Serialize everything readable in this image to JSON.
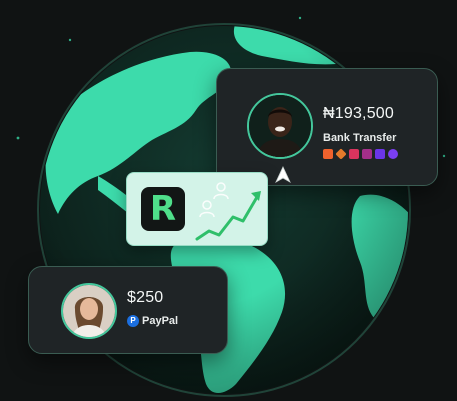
{
  "transfer_card": {
    "amount": "₦193,500",
    "method": "Bank Transfer",
    "bank_icons": [
      {
        "name": "gtbank-icon",
        "color": "#f0622d"
      },
      {
        "name": "access-bank-icon",
        "color": "#e57a2b"
      },
      {
        "name": "zenith-bank-icon",
        "color": "#d9345e"
      },
      {
        "name": "polaris-bank-icon",
        "color": "#a42f8a"
      },
      {
        "name": "kuda-bank-icon",
        "color": "#6b35e8"
      },
      {
        "name": "moniepoint-icon",
        "color": "#7b3ff2"
      }
    ]
  },
  "paypal_card": {
    "amount": "$250",
    "method": "PayPal",
    "paypal_icon_glyph": "P"
  },
  "brand": {
    "logo_letter": "R",
    "logo_color": "#4fdf8a"
  },
  "colors": {
    "background": "#101313",
    "globe_land": "#3ddbab",
    "globe_ocean": "#0d231e",
    "accent": "#44c79c"
  }
}
